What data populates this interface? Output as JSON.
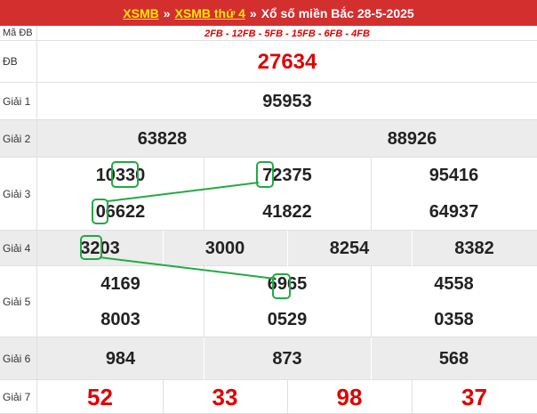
{
  "header": {
    "link1": "XSMB",
    "sep1": "»",
    "link2": "XSMB thứ 4",
    "sep2": "»",
    "title": "Xổ số miền Bắc 28-5-2025"
  },
  "rows": {
    "madb": {
      "label": "Mã ĐB",
      "value": "2FB - 12FB - 5FB - 15FB - 6FB - 4FB"
    },
    "db": {
      "label": "ĐB",
      "values": [
        "27634"
      ]
    },
    "g1": {
      "label": "Giải 1",
      "values": [
        "95953"
      ]
    },
    "g2": {
      "label": "Giải 2",
      "values": [
        "63828",
        "88926"
      ]
    },
    "g3": {
      "label": "Giải 3",
      "values": [
        "10330",
        "72375",
        "95416",
        "06622",
        "41822",
        "64937"
      ]
    },
    "g4": {
      "label": "Giải 4",
      "values": [
        "3203",
        "3000",
        "8254",
        "8382"
      ]
    },
    "g5": {
      "label": "Giải 5",
      "values": [
        "4169",
        "6965",
        "4558",
        "8003",
        "0529",
        "0358"
      ]
    },
    "g6": {
      "label": "Giải 6",
      "values": [
        "984",
        "873",
        "568"
      ]
    },
    "g7": {
      "label": "Giải 7",
      "values": [
        "52",
        "33",
        "98",
        "37"
      ]
    }
  },
  "colors": {
    "header_bg": "#d32f2f",
    "link": "#ffe600",
    "accent_red": "#e00000",
    "highlight_green": "#22aa44"
  }
}
